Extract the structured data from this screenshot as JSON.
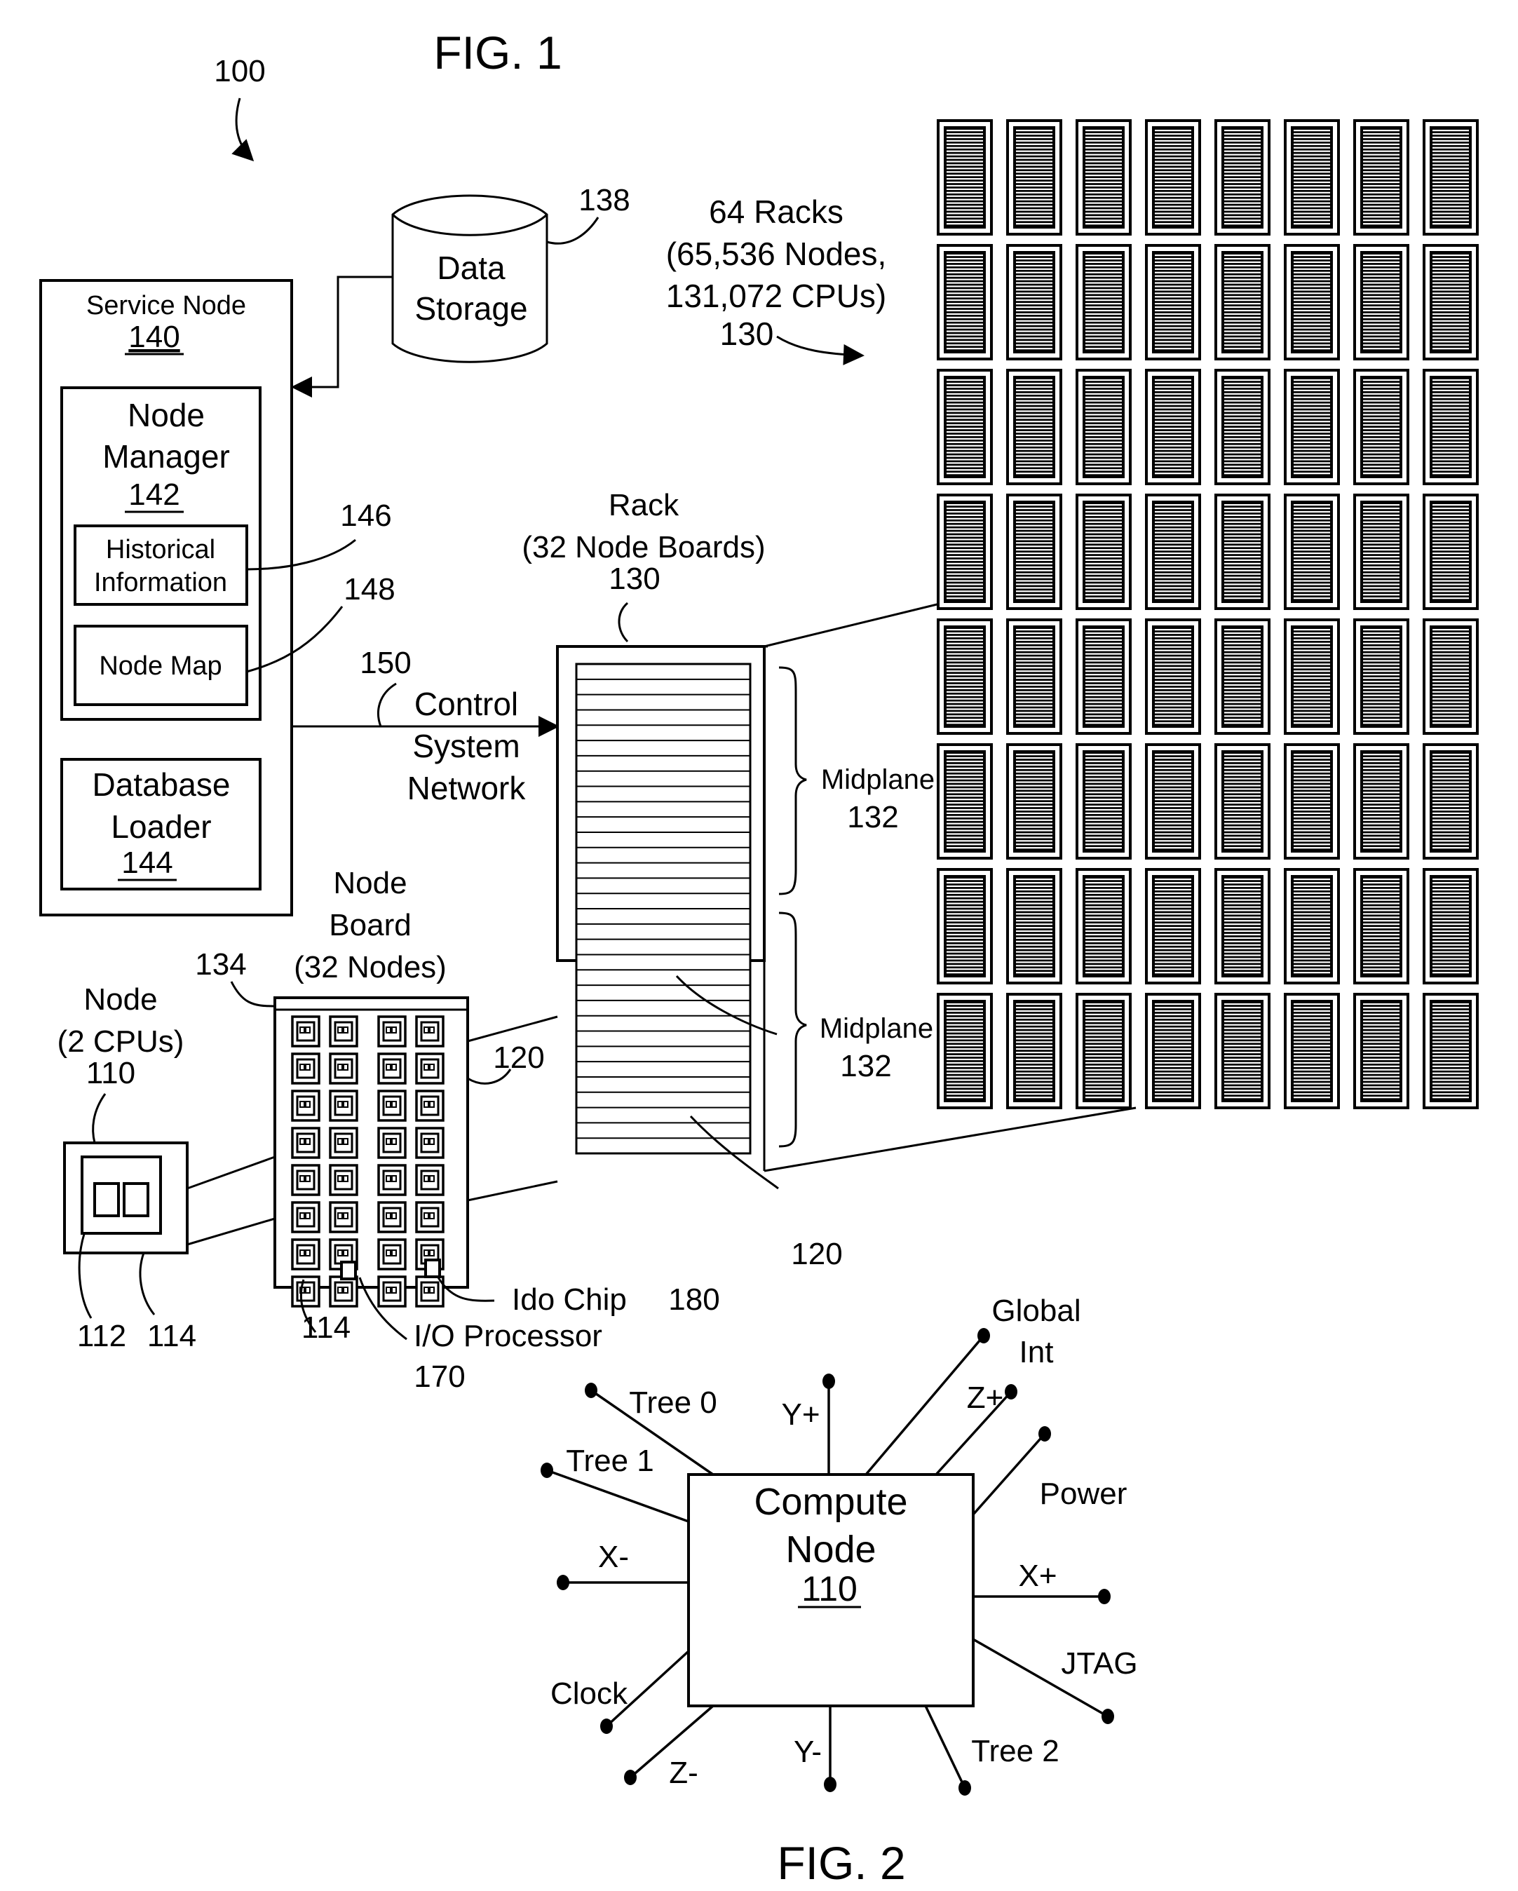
{
  "fig1": {
    "title": "FIG. 1",
    "ref_system": "100",
    "data_storage": {
      "line1": "Data",
      "line2": "Storage",
      "ref": "138"
    },
    "racks_note": {
      "line1": "64 Racks",
      "line2": "(65,536 Nodes,",
      "line3": "131,072 CPUs)",
      "ref": "130",
      "rows": 8,
      "cols": 8
    },
    "service_node": {
      "label": "Service Node",
      "ref": "140"
    },
    "node_manager": {
      "line1": "Node",
      "line2": "Manager",
      "ref": "142"
    },
    "historical_info": {
      "line1": "Historical",
      "line2": "Information",
      "ref": "146"
    },
    "node_map": {
      "label": "Node Map",
      "ref": "148"
    },
    "database_loader": {
      "line1": "Database",
      "line2": "Loader",
      "ref": "144"
    },
    "control_network": {
      "line1": "Control",
      "line2": "System",
      "line3": "Network",
      "ref": "150"
    },
    "rack": {
      "line1": "Rack",
      "line2": "(32 Node Boards)",
      "ref": "130",
      "board_ref": "120",
      "boards": 32
    },
    "midplanes": [
      {
        "label": "Midplane",
        "ref": "132"
      },
      {
        "label": "Midplane",
        "ref": "132"
      }
    ],
    "node_board": {
      "line1": "Node",
      "line2": "Board",
      "line3": "(32 Nodes)",
      "ref": "120",
      "top_ref": "134",
      "chip_ref": "114",
      "rows": 8,
      "cols": 4
    },
    "node": {
      "line1": "Node",
      "line2": "(2 CPUs)",
      "ref": "110",
      "cpu_ref": "112",
      "chip_ref": "114"
    },
    "ido_chip": {
      "label": "Ido Chip",
      "ref": "180"
    },
    "io_processor": {
      "label": "I/O Processor",
      "ref": "170"
    }
  },
  "fig2": {
    "title": "FIG. 2",
    "compute_node": {
      "line1": "Compute",
      "line2": "Node",
      "ref": "110"
    },
    "connections": [
      {
        "id": "tree0",
        "label": "Tree 0"
      },
      {
        "id": "tree1",
        "label": "Tree 1"
      },
      {
        "id": "yplus",
        "label": "Y+"
      },
      {
        "id": "global",
        "label": "Global",
        "label2": "Int"
      },
      {
        "id": "zplus",
        "label": "Z+"
      },
      {
        "id": "power",
        "label": "Power"
      },
      {
        "id": "xminus",
        "label": "X-"
      },
      {
        "id": "xplus",
        "label": "X+"
      },
      {
        "id": "jtag",
        "label": "JTAG"
      },
      {
        "id": "clock",
        "label": "Clock"
      },
      {
        "id": "zminus",
        "label": "Z-"
      },
      {
        "id": "yminus",
        "label": "Y-"
      },
      {
        "id": "tree2",
        "label": "Tree 2"
      }
    ]
  }
}
